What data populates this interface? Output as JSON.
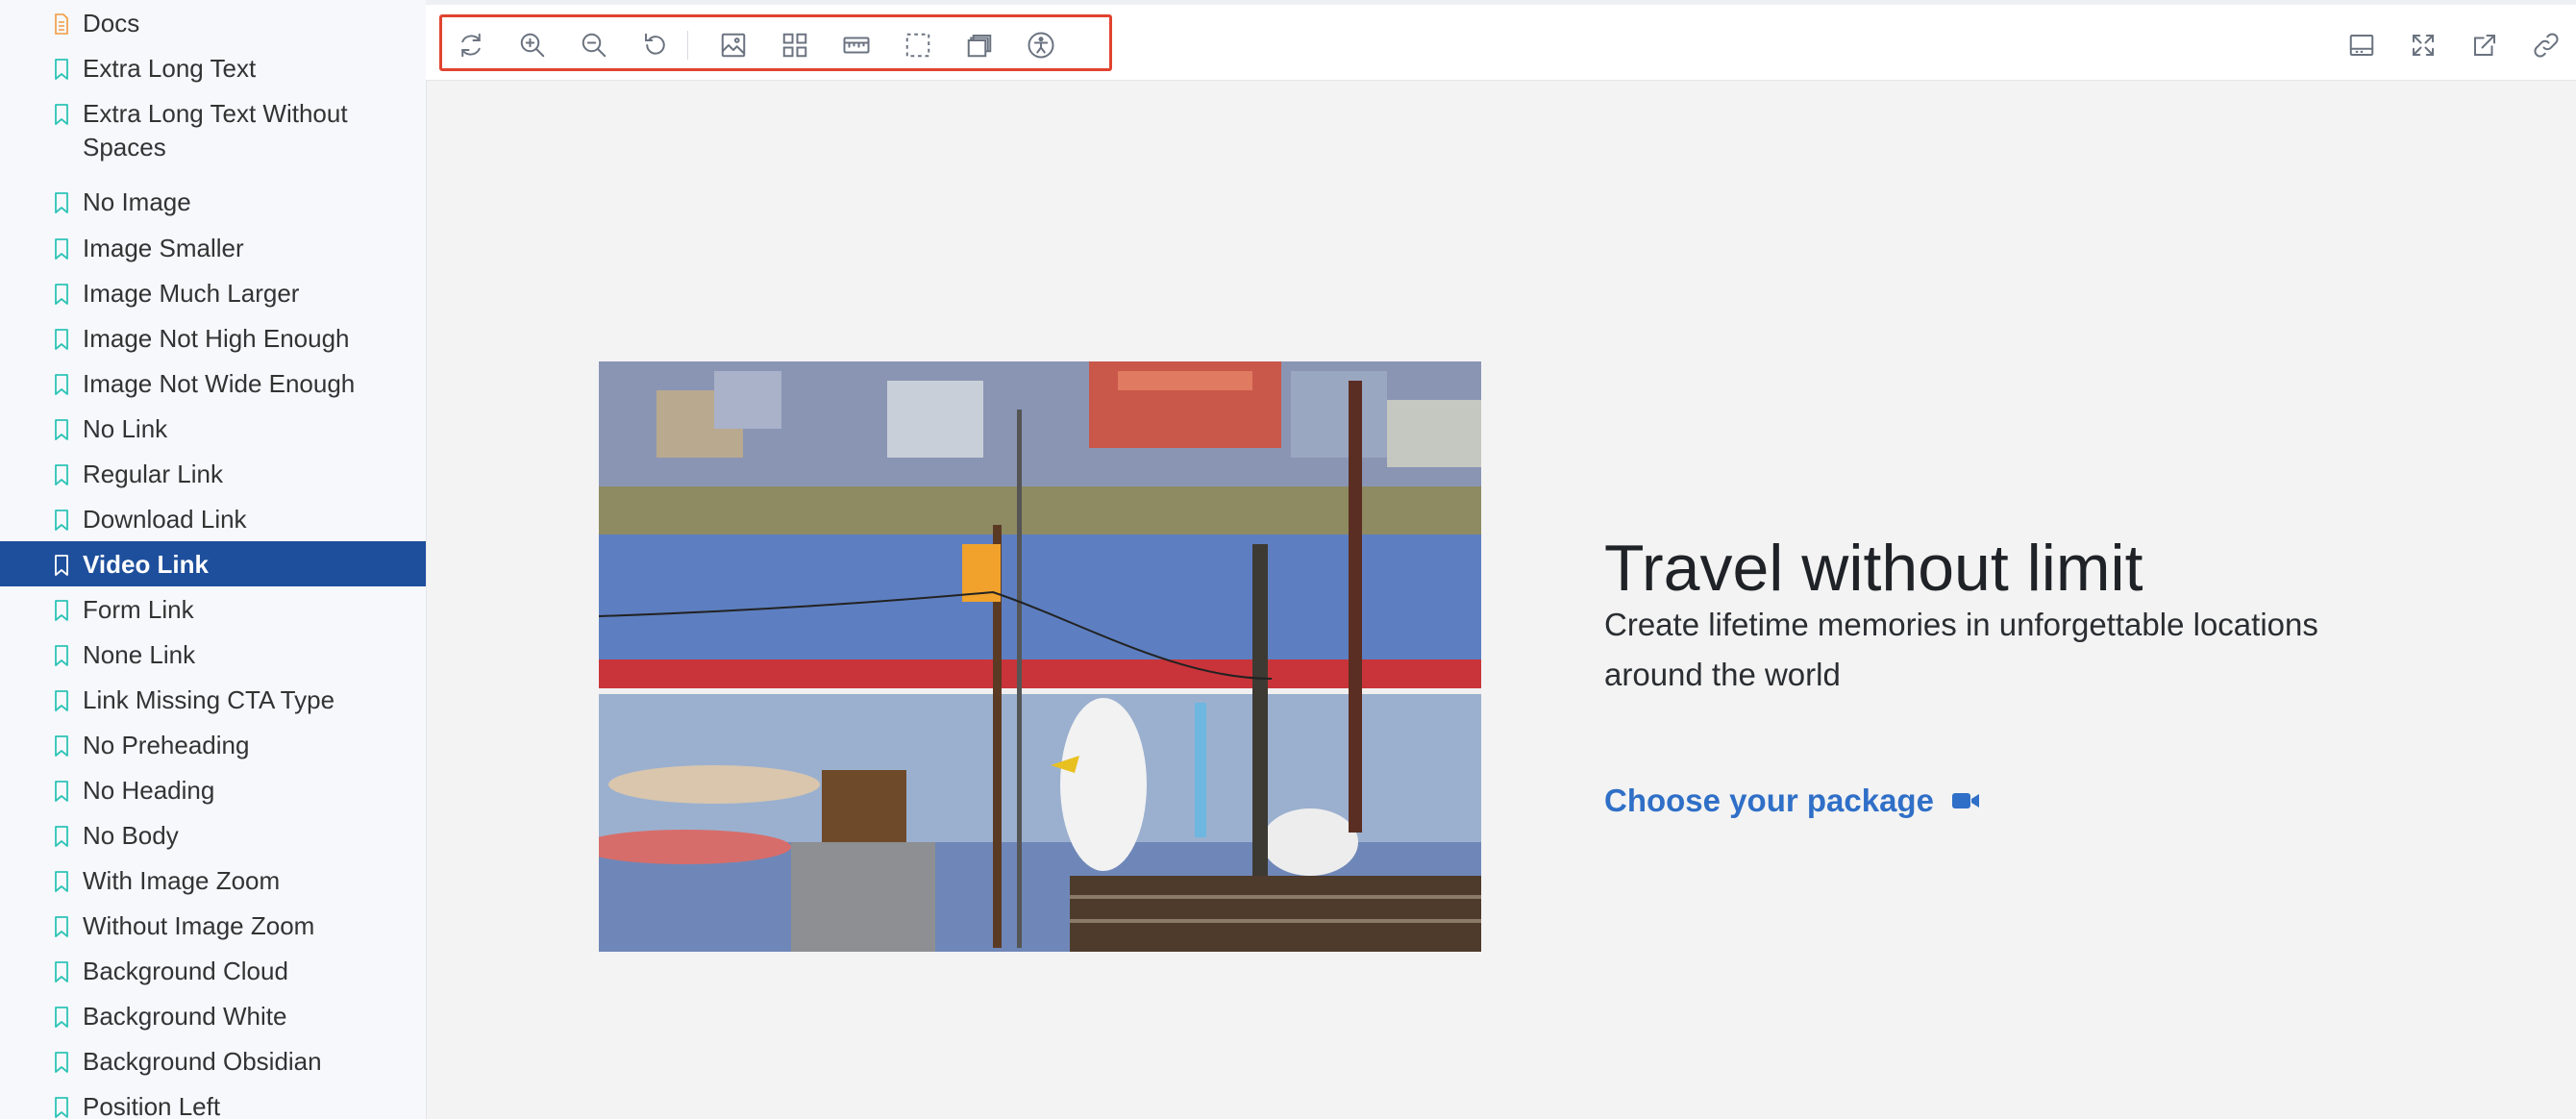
{
  "sidebar": {
    "items": [
      {
        "label": "Docs",
        "type": "doc"
      },
      {
        "label": "Extra Long Text",
        "type": "story"
      },
      {
        "label": "Extra Long Text Without Spaces",
        "type": "story"
      },
      {
        "label": "No Image",
        "type": "story"
      },
      {
        "label": "Image Smaller",
        "type": "story"
      },
      {
        "label": "Image Much Larger",
        "type": "story"
      },
      {
        "label": "Image Not High Enough",
        "type": "story"
      },
      {
        "label": "Image Not Wide Enough",
        "type": "story"
      },
      {
        "label": "No Link",
        "type": "story"
      },
      {
        "label": "Regular Link",
        "type": "story"
      },
      {
        "label": "Download Link",
        "type": "story"
      },
      {
        "label": "Video Link",
        "type": "story",
        "active": true
      },
      {
        "label": "Form Link",
        "type": "story"
      },
      {
        "label": "None Link",
        "type": "story"
      },
      {
        "label": "Link Missing CTA Type",
        "type": "story"
      },
      {
        "label": "No Preheading",
        "type": "story"
      },
      {
        "label": "No Heading",
        "type": "story"
      },
      {
        "label": "No Body",
        "type": "story"
      },
      {
        "label": "With Image Zoom",
        "type": "story"
      },
      {
        "label": "Without Image Zoom",
        "type": "story"
      },
      {
        "label": "Background Cloud",
        "type": "story"
      },
      {
        "label": "Background White",
        "type": "story"
      },
      {
        "label": "Background Obsidian",
        "type": "story"
      },
      {
        "label": "Position Left",
        "type": "story"
      }
    ]
  },
  "toolbar": {
    "left_icons": [
      "reload-icon",
      "zoom-in-icon",
      "zoom-out-icon",
      "reset-zoom-icon",
      "background-image-icon",
      "grid-icon",
      "measure-icon",
      "outline-icon",
      "viewport-icon",
      "accessibility-icon"
    ],
    "right_icons": [
      "panel-toggle-icon",
      "fullscreen-icon",
      "open-new-tab-icon",
      "copy-link-icon"
    ]
  },
  "main": {
    "heading": "Travel without limit",
    "body": "Create lifetime memories in unforgettable locations around the world",
    "cta_label": "Choose your package",
    "cta_icon": "video-camera-icon"
  },
  "colors": {
    "accent": "#1e4f9c",
    "link": "#2f6fc7",
    "highlight_border": "#e0432f",
    "story_icon": "#2ec4b6",
    "doc_icon": "#f19a3e"
  }
}
